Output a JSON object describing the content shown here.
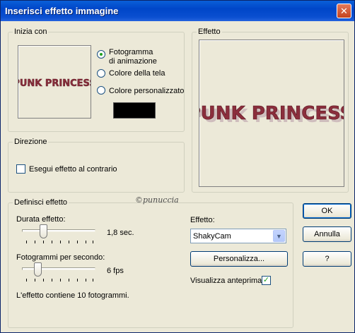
{
  "window": {
    "title": "Inserisci effetto immagine",
    "close_glyph": "✕"
  },
  "start": {
    "legend": "Inizia con",
    "preview_logo": "PUNK PRINCESS",
    "options": [
      {
        "label_line1": "Fotogramma",
        "label_line2": "di animazione",
        "selected": true
      },
      {
        "label": "Colore della tela",
        "selected": false
      },
      {
        "label": "Colore personalizzato",
        "selected": false
      }
    ],
    "custom_color": "#000000"
  },
  "effect_preview": {
    "legend": "Effetto",
    "logo": "PUNK PRINCESS"
  },
  "direction": {
    "legend": "Direzione",
    "reverse_label": "Esegui effetto al contrario",
    "reverse_checked": false
  },
  "define": {
    "legend": "Definisci effetto",
    "duration_label": "Durata effetto:",
    "duration_value": "1,8 sec.",
    "duration_fraction": 0.27,
    "fps_label": "Fotogrammi per secondo:",
    "fps_value": "6 fps",
    "fps_fraction": 0.18,
    "info": "L'effetto contiene 10 fotogrammi.",
    "effect_label": "Effetto:",
    "effect_selected": "ShakyCam",
    "customize_label": "Personalizza...",
    "show_preview_label": "Visualizza anteprima",
    "show_preview_checked": true,
    "watermark": "©punuccia"
  },
  "buttons": {
    "ok": "OK",
    "cancel": "Annulla",
    "help": "?"
  },
  "check_glyph": "✓",
  "colors": {
    "logo": "#8b2e3c",
    "titlebar": "#0a4fd0"
  }
}
